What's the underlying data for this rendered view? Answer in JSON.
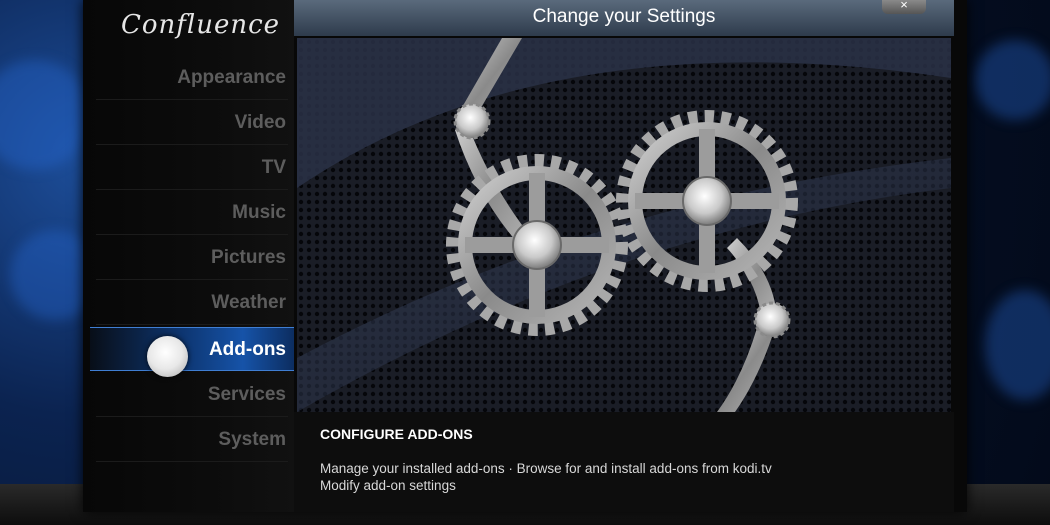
{
  "skin": {
    "logo_text": "Confluence"
  },
  "header": {
    "title": "Change your Settings",
    "close_label": "×"
  },
  "menu": [
    {
      "label": "Appearance"
    },
    {
      "label": "Video"
    },
    {
      "label": "TV"
    },
    {
      "label": "Music"
    },
    {
      "label": "Pictures"
    },
    {
      "label": "Weather"
    },
    {
      "label": "Add-ons",
      "selected": true
    },
    {
      "label": "Services"
    },
    {
      "label": "System"
    }
  ],
  "panel": {
    "title": "CONFIGURE ADD-ONS",
    "line1": "Manage your installed add-ons · Browse for and install add-ons from kodi.tv",
    "line2": "Modify add-on settings"
  },
  "colors": {
    "accent": "#1653a8",
    "header": "#4a5a6c"
  }
}
